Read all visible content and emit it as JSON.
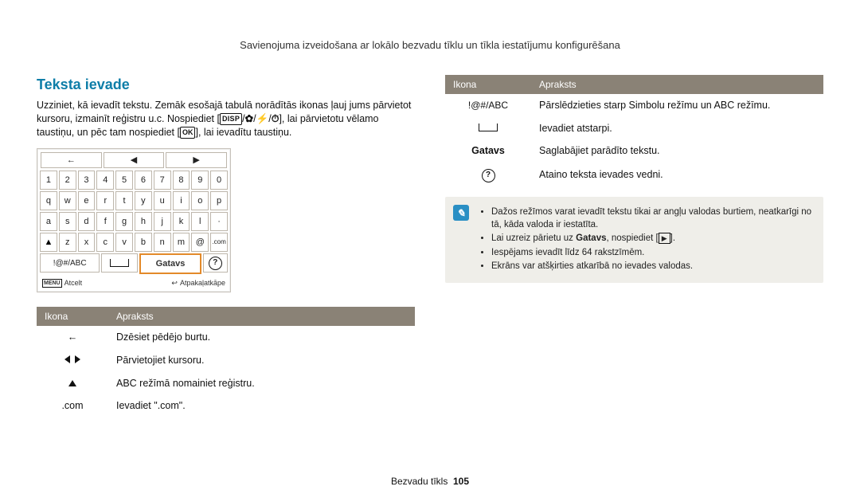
{
  "breadcrumb": "Savienojuma izveidošana ar lokālo bezvadu tīklu un tīkla iestatījumu konfigurēšana",
  "heading": "Teksta ievade",
  "intro_1": "Uzziniet, kā ievadīt tekstu. Zemāk esošajā tabulā norādītās ikonas ļauj jums pārvietot kursoru, izmainīt reģistru u.c. Nospiediet [",
  "intro_2": "], lai pārvietotu vēlamo taustiņu, un pēc tam nospiediet [",
  "intro_3": "], lai ievadītu taustiņu.",
  "disp_label": "DISP",
  "ok_label": "OK",
  "keyboard": {
    "top": [
      "←",
      "◀",
      "▶"
    ],
    "r1": [
      "1",
      "2",
      "3",
      "4",
      "5",
      "6",
      "7",
      "8",
      "9",
      "0"
    ],
    "r2": [
      "q",
      "w",
      "e",
      "r",
      "t",
      "y",
      "u",
      "i",
      "o",
      "p"
    ],
    "r3": [
      "a",
      "s",
      "d",
      "f",
      "g",
      "h",
      "j",
      "k",
      "l",
      "·"
    ],
    "r4_shift": "▲",
    "r4": [
      "z",
      "x",
      "c",
      "v",
      "b",
      "n",
      "m",
      "@"
    ],
    "r4_com": ".com",
    "r5_abc": "!@#/ABC",
    "r5_space": "⌴",
    "r5_gatavs": "Gatavs",
    "r5_help": "?",
    "btm_menu": "MENU",
    "btm_cancel": "Atcelt",
    "btm_back_icon": "↩",
    "btm_back": "Atpakaļatkāpe"
  },
  "table_left": {
    "h1": "Ikona",
    "h2": "Apraksts",
    "r1_desc": "Dzēsiet pēdējo burtu.",
    "r2_desc": "Pārvietojiet kursoru.",
    "r3_desc": "ABC režīmā nomainiet reģistru.",
    "r4_icon": ".com",
    "r4_desc": "Ievadiet \".com\"."
  },
  "table_right": {
    "h1": "Ikona",
    "h2": "Apraksts",
    "r1_icon": "!@#/ABC",
    "r1_desc": "Pārslēdzieties starp Simbolu režīmu un ABC režīmu.",
    "r2_desc": "Ievadiet atstarpi.",
    "r3_icon": "Gatavs",
    "r3_desc": "Saglabājiet parādīto tekstu.",
    "r4_desc": "Ataino teksta ievades vedni."
  },
  "note": {
    "b1a": "Dažos režīmos varat ievadīt tekstu tikai ar angļu valodas burtiem, neatkarīgi no tā, kāda valoda ir iestatīta.",
    "b2_pre": "Lai uzreiz pārietu uz ",
    "b2_bold": "Gatavs",
    "b2_post": ", nospiediet [",
    "b2_end": "].",
    "b3": "Iespējams ievadīt līdz 64 rakstzīmēm.",
    "b4": "Ekrāns var atšķirties atkarībā no ievades valodas."
  },
  "footer_label": "Bezvadu tīkls",
  "footer_page": "105"
}
